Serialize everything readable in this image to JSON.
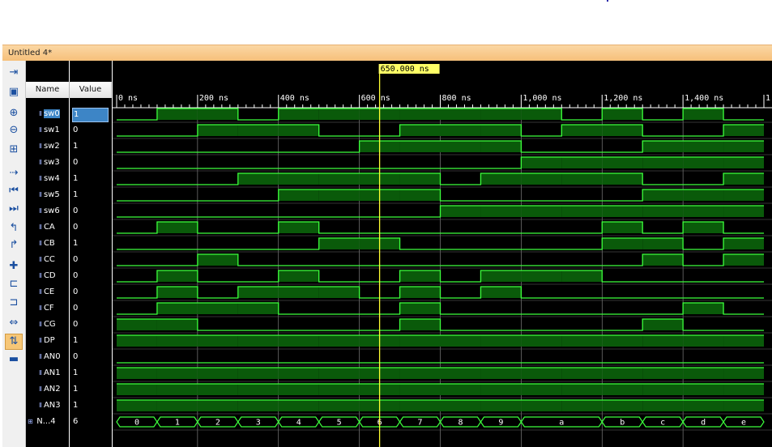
{
  "window": {
    "title": "Untitled 4*"
  },
  "columns": {
    "name": "Name",
    "value": "Value"
  },
  "cursor": {
    "label": "650.000 ns",
    "time_ns": 650
  },
  "time_axis": {
    "labels": [
      "0 ns",
      "200 ns",
      "400 ns",
      "600 ns",
      "800 ns",
      "1,000 ns",
      "1,200 ns",
      "1,400 ns",
      "1"
    ],
    "range_ns": [
      0,
      1600
    ]
  },
  "toolbar": [
    {
      "icon": "zoom-fit-icon"
    },
    {
      "icon": "save-icon"
    },
    {
      "icon": "zoom-in-icon"
    },
    {
      "icon": "zoom-out-icon"
    },
    {
      "icon": "zoom-full-icon"
    },
    {
      "icon": "goto-cursor-icon"
    },
    {
      "icon": "goto-start-icon"
    },
    {
      "icon": "goto-end-icon"
    },
    {
      "icon": "prev-transition-icon"
    },
    {
      "icon": "next-transition-icon"
    },
    {
      "icon": "add-marker-icon"
    },
    {
      "icon": "prev-marker-icon"
    },
    {
      "icon": "next-marker-icon"
    },
    {
      "icon": "swap-cursors-icon"
    },
    {
      "icon": "snap-transition-icon"
    },
    {
      "icon": "floating-ruler-icon"
    }
  ],
  "signals": [
    {
      "name": "sw0",
      "value": "1",
      "selected": true
    },
    {
      "name": "sw1",
      "value": "0"
    },
    {
      "name": "sw2",
      "value": "1"
    },
    {
      "name": "sw3",
      "value": "0"
    },
    {
      "name": "sw4",
      "value": "1"
    },
    {
      "name": "sw5",
      "value": "1"
    },
    {
      "name": "sw6",
      "value": "0"
    },
    {
      "name": "CA",
      "value": "0"
    },
    {
      "name": "CB",
      "value": "1"
    },
    {
      "name": "CC",
      "value": "0"
    },
    {
      "name": "CD",
      "value": "0"
    },
    {
      "name": "CE",
      "value": "0"
    },
    {
      "name": "CF",
      "value": "0"
    },
    {
      "name": "CG",
      "value": "0"
    },
    {
      "name": "DP",
      "value": "1"
    },
    {
      "name": "AN0",
      "value": "0"
    },
    {
      "name": "AN1",
      "value": "1"
    },
    {
      "name": "AN2",
      "value": "1"
    },
    {
      "name": "AN3",
      "value": "1"
    },
    {
      "name": "N...4",
      "value": "6",
      "bus": true
    }
  ],
  "waves": [
    [
      0,
      1,
      1,
      0,
      1,
      1,
      1,
      1,
      1,
      1,
      1,
      0,
      1,
      0,
      1,
      0
    ],
    [
      0,
      0,
      1,
      1,
      1,
      0,
      0,
      1,
      1,
      1,
      0,
      1,
      1,
      0,
      0,
      1
    ],
    [
      0,
      0,
      0,
      0,
      0,
      0,
      1,
      1,
      1,
      1,
      0,
      0,
      0,
      1,
      1,
      1
    ],
    [
      0,
      0,
      0,
      0,
      0,
      0,
      0,
      0,
      0,
      0,
      1,
      1,
      1,
      1,
      1,
      1
    ],
    [
      0,
      0,
      0,
      1,
      1,
      1,
      1,
      1,
      0,
      1,
      1,
      1,
      1,
      0,
      0,
      1
    ],
    [
      0,
      0,
      0,
      0,
      1,
      1,
      1,
      1,
      0,
      0,
      0,
      0,
      0,
      1,
      1,
      1
    ],
    [
      0,
      0,
      0,
      0,
      0,
      0,
      0,
      0,
      1,
      1,
      1,
      1,
      1,
      1,
      1,
      1
    ],
    [
      0,
      1,
      0,
      0,
      1,
      0,
      0,
      0,
      0,
      0,
      0,
      0,
      1,
      0,
      1,
      0
    ],
    [
      0,
      0,
      0,
      0,
      0,
      1,
      1,
      0,
      0,
      0,
      0,
      0,
      1,
      1,
      0,
      1
    ],
    [
      0,
      0,
      1,
      0,
      0,
      0,
      0,
      0,
      0,
      0,
      0,
      0,
      0,
      1,
      0,
      1
    ],
    [
      0,
      1,
      0,
      0,
      1,
      0,
      0,
      1,
      0,
      1,
      1,
      1,
      0,
      0,
      0,
      0
    ],
    [
      0,
      1,
      0,
      1,
      1,
      1,
      0,
      1,
      0,
      1,
      0,
      0,
      0,
      0,
      0,
      0
    ],
    [
      0,
      1,
      1,
      1,
      0,
      0,
      0,
      1,
      0,
      0,
      0,
      0,
      0,
      0,
      1,
      0
    ],
    [
      1,
      1,
      0,
      0,
      0,
      0,
      0,
      1,
      0,
      0,
      0,
      0,
      0,
      1,
      0,
      0
    ],
    [
      1,
      1,
      1,
      1,
      1,
      1,
      1,
      1,
      1,
      1,
      1,
      1,
      1,
      1,
      1,
      1
    ],
    [
      0,
      0,
      0,
      0,
      0,
      0,
      0,
      0,
      0,
      0,
      0,
      0,
      0,
      0,
      0,
      0
    ],
    [
      1,
      1,
      1,
      1,
      1,
      1,
      1,
      1,
      1,
      1,
      1,
      1,
      1,
      1,
      1,
      1
    ],
    [
      1,
      1,
      1,
      1,
      1,
      1,
      1,
      1,
      1,
      1,
      1,
      1,
      1,
      1,
      1,
      1
    ],
    [
      1,
      1,
      1,
      1,
      1,
      1,
      1,
      1,
      1,
      1,
      1,
      1,
      1,
      1,
      1,
      1
    ]
  ],
  "bus_values": [
    "0",
    "1",
    "2",
    "3",
    "4",
    "5",
    "6",
    "7",
    "8",
    "9",
    "a",
    "a",
    "b",
    "c",
    "d",
    "e"
  ]
}
